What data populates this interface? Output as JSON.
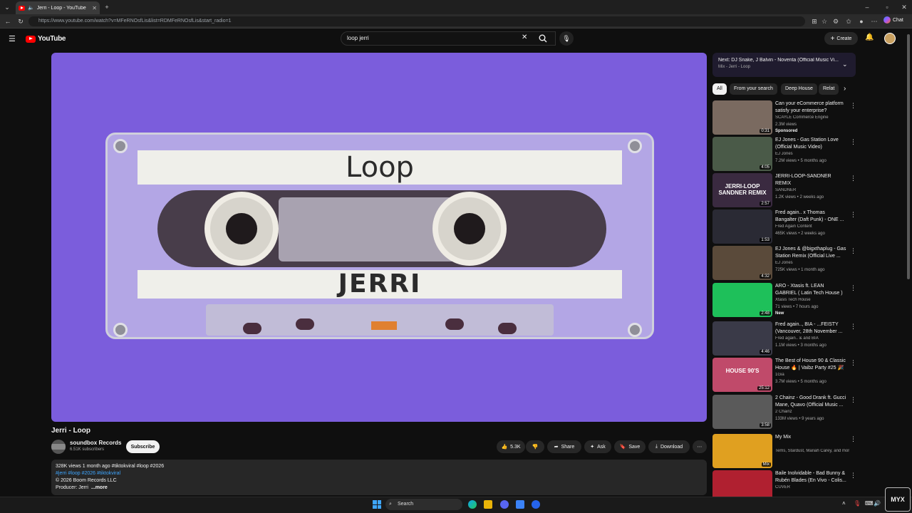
{
  "browser": {
    "tab_title": "Jerri - Loop - YouTube",
    "url": "https://www.youtube.com/watch?v=MFeRNOsfLis&list=RDMFeRNOsfLis&start_radio=1",
    "chat_label": "Chat"
  },
  "header": {
    "logo_text": "YouTube",
    "search_value": "loop jerri",
    "create_label": "Create"
  },
  "video": {
    "cassette_top_label": "Loop",
    "cassette_bottom_label": "JERRI",
    "title": "Jerri - Loop",
    "channel": "soundbox Records",
    "subscribers": "6.51K subscribers",
    "subscribe_label": "Subscribe",
    "likes": "5.3K",
    "share_label": "Share",
    "ask_label": "Ask",
    "save_label": "Save",
    "download_label": "Download",
    "description": {
      "stats_line": "328K views  1 month ago  #tiktokviral #loop #2026",
      "tags_line": "#jerri #loop #2026 #tiktokviral",
      "copyright_line": "© 2026 Boom Records LLC",
      "producer_line": "Producer: Jerri",
      "more_label": "...more"
    }
  },
  "sidebar": {
    "next_title": "Next: DJ Snake, J Balvin - Noventa (Official Music Vi...",
    "next_sub": "Mix - Jerri - Loop",
    "chips": [
      "All",
      "From your search",
      "Deep House",
      "Relat"
    ],
    "recommendations": [
      {
        "title": "Can your eCommerce platform satisfy your enterprise?",
        "channel": "SCAYLE Commerce Engine",
        "meta": "2.3M views",
        "badge": "Sponsored",
        "duration": "0:31",
        "thumb": "#7a6a60"
      },
      {
        "title": "EJ Jones - Gas Station Love (Official Music Video)",
        "channel": "EJ Jones",
        "meta": "7.2M views • 5 months ago",
        "badge": "",
        "duration": "4:05",
        "thumb": "#4a5a48"
      },
      {
        "title": "JERRI-LOOP-SANDNER REMIX",
        "channel": "SANDNER",
        "meta": "1.2K views • 2 weeks ago",
        "badge": "",
        "duration": "2:57",
        "thumb": "#3a2a40",
        "overlay": "JERRI-LOOP SANDNER REMIX"
      },
      {
        "title": "Fred again.. x Thomas Bangalter (Daft Punk) - ONE ...",
        "channel": "Fred Again Content",
        "meta": "465K views • 2 weeks ago",
        "badge": "",
        "duration": "1:53",
        "thumb": "#2a2a34"
      },
      {
        "title": "EJ Jones & @bigxthaplug - Gas Station Remix (Official Live ...",
        "channel": "EJ Jones",
        "meta": "725K views • 1 month ago",
        "badge": "",
        "duration": "4:32",
        "thumb": "#5a4a3a"
      },
      {
        "title": "ARO - Xtasis ft. LEAN GABRIEL ( Latin Tech House ) AFTERMIX...",
        "channel": "Xtasis Tech House",
        "meta": "71 views • 7 hours ago",
        "badge": "New",
        "duration": "2:48",
        "thumb": "#1ec05a"
      },
      {
        "title": "Fred again.., BIA - ...FEISTY (Vancouver, 28th November ...",
        "channel": "Fred again.. & and BIA",
        "meta": "1.1M views • 3 months ago",
        "badge": "",
        "duration": "4:46",
        "thumb": "#3a3a48"
      },
      {
        "title": "The Best of House 90 & Classic House 🔥 | Vaibz Party #25 🎉 ...",
        "channel": "1Gia",
        "meta": "3.7M views • 5 months ago",
        "badge": "",
        "duration": "25:12",
        "thumb": "#c04a6a",
        "overlay": "HOUSE 90'S"
      },
      {
        "title": "2 Chainz - Good Drank ft. Gucci Mane, Quavo (Official Music ...",
        "channel": "2 Chainz",
        "meta": "133M views • 9 years ago",
        "badge": "",
        "duration": "3:58",
        "thumb": "#5a5a5a"
      },
      {
        "title": "My Mix",
        "channel": "Tems, Stardust, Mariah Carey, and more",
        "meta": "",
        "badge": "",
        "duration": "Mix",
        "thumb": "#e0a020"
      },
      {
        "title": "Baile Inolvidable - Bad Bunny & Rubén Blades (En Vivo - Colis...",
        "channel": "CUVER",
        "meta": "",
        "badge": "",
        "duration": "",
        "thumb": "#b02030"
      }
    ]
  },
  "taskbar": {
    "search_label": "Search"
  }
}
